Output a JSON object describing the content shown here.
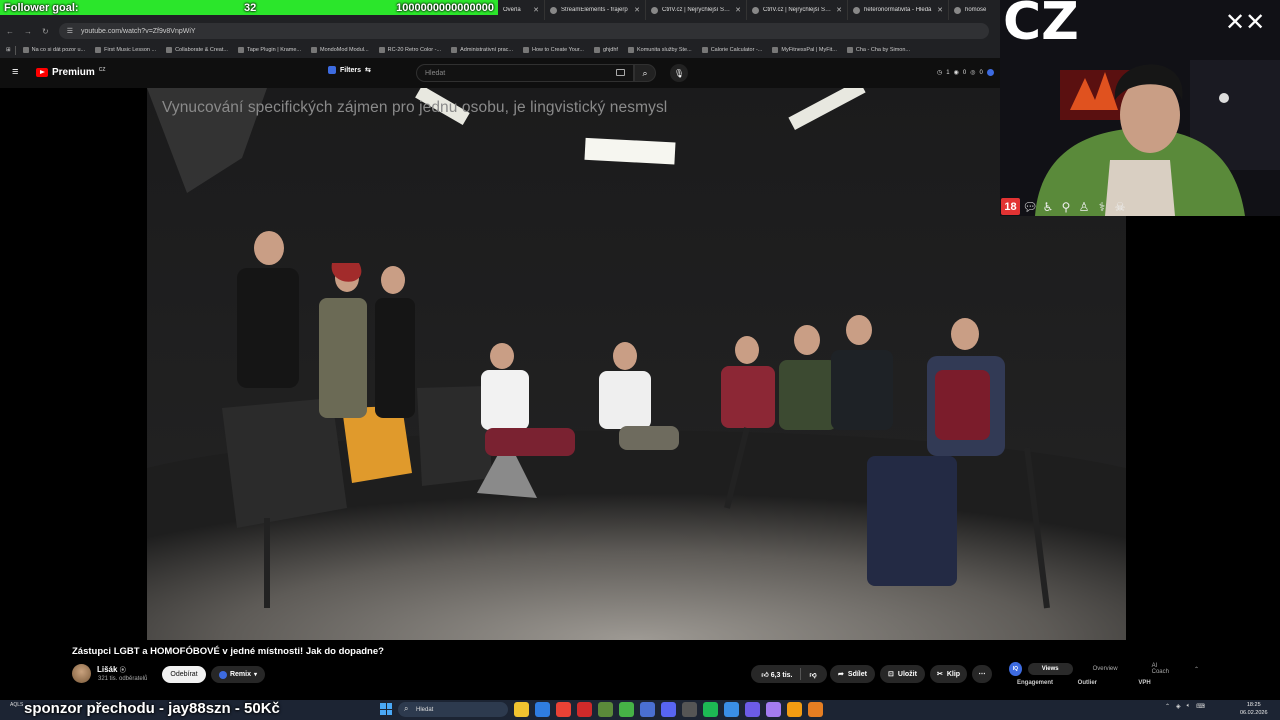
{
  "goal": {
    "label": "Follower goal:",
    "current": "32",
    "target": "1000000000000000"
  },
  "browser": {
    "tabs": [
      {
        "label": "Overla",
        "icon": "page-icon"
      },
      {
        "label": "StreamElements - frajerp",
        "icon": "streamelements-icon"
      },
      {
        "label": "CtrlV.cz | Nejrychlejší Scre",
        "icon": "ctrlv-icon"
      },
      {
        "label": "CtrlV.cz | Nejrychlejší Scre",
        "icon": "ctrlv-icon"
      },
      {
        "label": "heteronormativita - Hledá",
        "icon": "google-icon"
      },
      {
        "label": "homose",
        "icon": "google-icon"
      }
    ],
    "url": "youtube.com/watch?v=Zf9v8VnpWiY",
    "bookmarks": [
      "Na co si dát pozor u...",
      "First Music Lesson ...",
      "Collaborate & Creat...",
      "Tape Plugin | Krame...",
      "MondoMod Modul...",
      "RC-20 Retro Color -...",
      "Administrativní prac...",
      "How to Create Your...",
      "ghjdhf",
      "Komunita služby Ste...",
      "Calorie Calculator -...",
      "MyFitnessPal | MyFit...",
      "Cha - Cha by Simon..."
    ]
  },
  "youtube": {
    "brand": "Premium",
    "region": "CZ",
    "filters_label": "Filters",
    "search_placeholder": "Hledat",
    "header_stats": [
      "1",
      "0",
      "0"
    ],
    "caption": "Vynucování specifických zájmen pro jednu osobu, je lingvistický nesmysl",
    "video_title": "Zástupci LGBT a HOMOFÓBOVÉ v jedné místnosti! Jak do dopadne?",
    "channel": {
      "name": "Lišák",
      "subscribers": "321 tis. odběratelů"
    },
    "unsubscribe_label": "Odebírat",
    "remix_label": "Remix",
    "like_count": "6,3 tis.",
    "share_label": "Sdílet",
    "save_label": "Uložit",
    "clip_label": "Klip",
    "vidiq": {
      "logo": "IQ",
      "tabs": [
        "Views",
        "Overview",
        "AI Coach"
      ],
      "active_tab": "Views",
      "columns": [
        "Engagement",
        "Outlier",
        "VPH"
      ]
    }
  },
  "stream": {
    "webcam_title": "CZ",
    "sponsor_text": "sponzor přechodu - jay88szn - 50Kč",
    "badge_18": "18"
  },
  "taskbar": {
    "weather": "AQLS",
    "search_placeholder": "Hledat",
    "time": "18:25",
    "date": "06.02.2026",
    "icon_colors": [
      "#f0c330",
      "#2f7de1",
      "#e94235",
      "#cf2a2a",
      "#5b8a3a",
      "#46b246",
      "#4a6fd1",
      "#5865f2",
      "#555",
      "#1db954",
      "#3a8ee6",
      "#6c5ce7",
      "#a37cf0",
      "#f39c12",
      "#e67e22"
    ]
  }
}
